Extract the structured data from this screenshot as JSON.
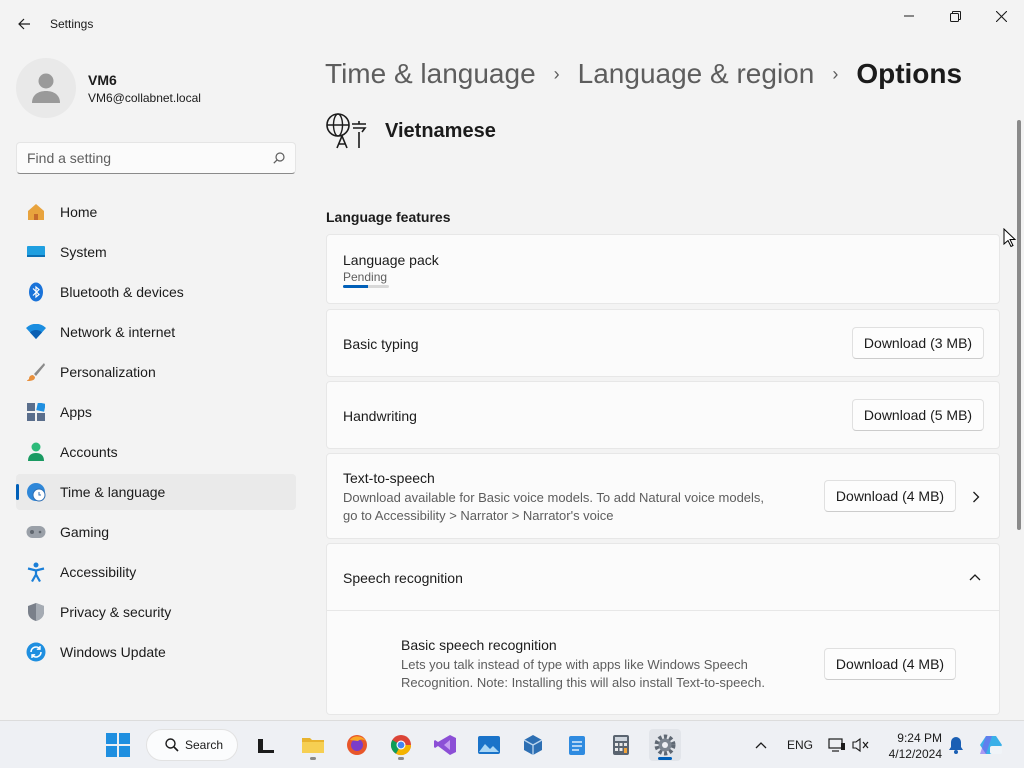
{
  "window": {
    "title": "Settings",
    "back_label": "Back",
    "min_label": "Minimize",
    "max_label": "Maximize",
    "close_label": "Close"
  },
  "profile": {
    "name": "VM6",
    "email": "VM6@collabnet.local"
  },
  "search": {
    "placeholder": "Find a setting"
  },
  "sidebar": {
    "items": [
      {
        "label": "Home",
        "icon": "home-icon"
      },
      {
        "label": "System",
        "icon": "system-icon"
      },
      {
        "label": "Bluetooth & devices",
        "icon": "bluetooth-icon"
      },
      {
        "label": "Network & internet",
        "icon": "wifi-icon"
      },
      {
        "label": "Personalization",
        "icon": "brush-icon"
      },
      {
        "label": "Apps",
        "icon": "apps-icon"
      },
      {
        "label": "Accounts",
        "icon": "accounts-icon"
      },
      {
        "label": "Time & language",
        "icon": "globe-clock-icon",
        "active": true
      },
      {
        "label": "Gaming",
        "icon": "gamepad-icon"
      },
      {
        "label": "Accessibility",
        "icon": "accessibility-icon"
      },
      {
        "label": "Privacy & security",
        "icon": "shield-icon"
      },
      {
        "label": "Windows Update",
        "icon": "update-icon"
      }
    ]
  },
  "breadcrumb": {
    "items": [
      "Time & language",
      "Language & region"
    ],
    "separator": "›",
    "current": "Options"
  },
  "language": {
    "name": "Vietnamese"
  },
  "section_title": "Language features",
  "features": {
    "language_pack": {
      "title": "Language pack",
      "status": "Pending",
      "progress": 0.55
    },
    "basic_typing": {
      "title": "Basic typing",
      "button": "Download (3 MB)"
    },
    "handwriting": {
      "title": "Handwriting",
      "button": "Download (5 MB)"
    },
    "tts": {
      "title": "Text-to-speech",
      "desc_line1": "Download available for Basic voice models. To add Natural voice models,",
      "desc_line2": "go to Accessibility > Narrator > Narrator's voice",
      "button": "Download (4 MB)"
    },
    "speech": {
      "title": "Speech recognition"
    },
    "basic_speech": {
      "title": "Basic speech recognition",
      "desc_line1": "Lets you talk instead of type with apps like Windows Speech",
      "desc_line2": "Recognition. Note: Installing this will also install Text-to-speech.",
      "button": "Download (4 MB)"
    }
  },
  "taskbar": {
    "search_label": "Search",
    "lang": "ENG",
    "time": "9:24 PM",
    "date": "4/12/2024"
  },
  "colors": {
    "accent": "#005fb8",
    "background": "#f3f3f3",
    "card": "#fbfbfb"
  }
}
